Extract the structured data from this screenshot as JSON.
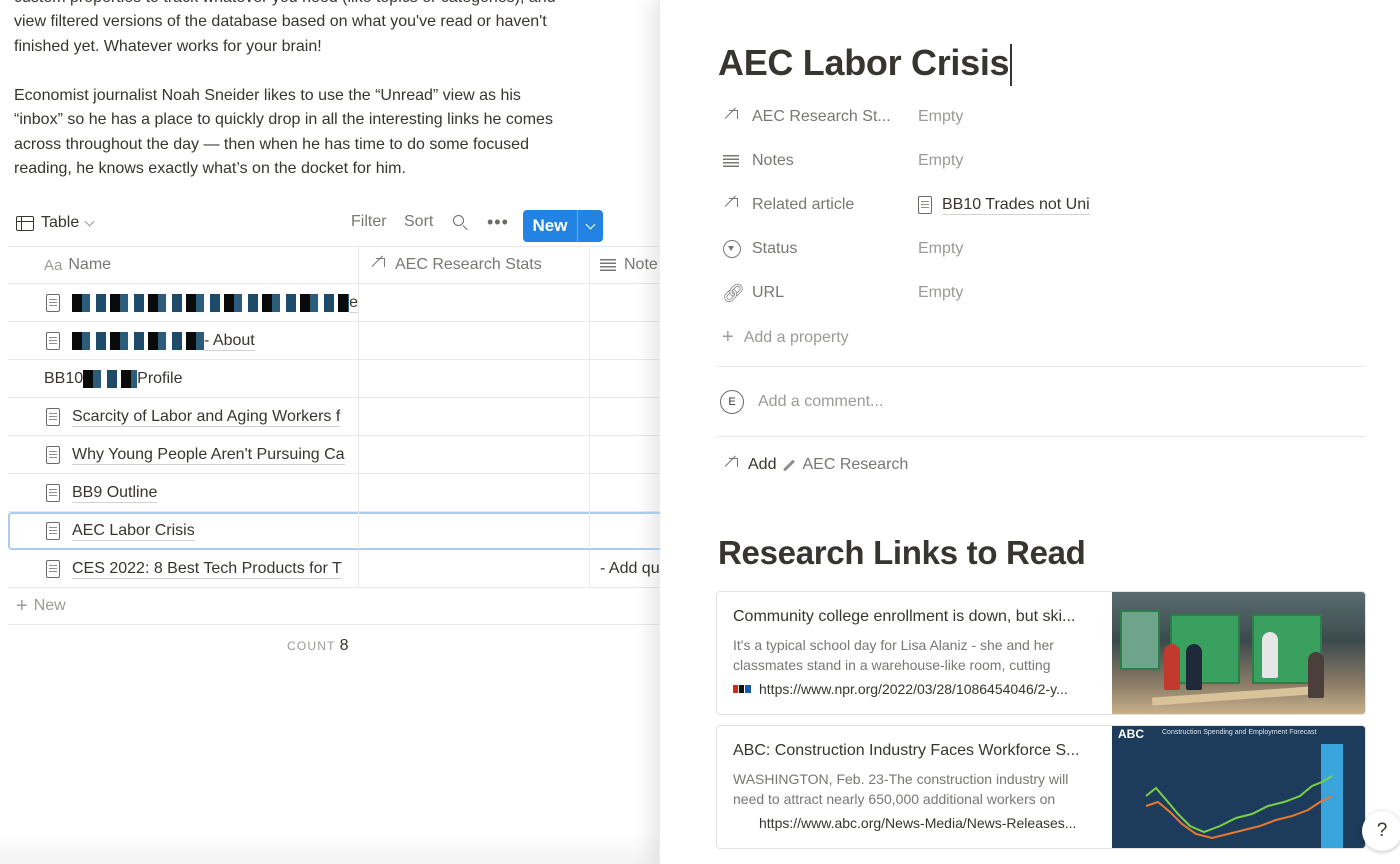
{
  "left": {
    "intro_paragraph_1": "custom properties to track whatever you need (like topics or categories), and view filtered versions of the database based on what you've read or haven't finished yet. Whatever works for your brain!",
    "intro_paragraph_2": "Economist journalist Noah Sneider likes to use the “Unread” view as his “inbox” so he has a place to quickly drop in all the interesting links he comes across throughout the day — then when he has time to do some focused reading, he knows exactly what’s on the docket for him.",
    "view_label": "Table",
    "toolbar": {
      "filter": "Filter",
      "sort": "Sort",
      "more": "•••",
      "new": "New"
    },
    "columns": {
      "name_prefix": "Aa",
      "name": "Name",
      "stats": "AEC Research Stats",
      "notes": "Note"
    },
    "rows": [
      {
        "suffix": "e",
        "notes": ""
      },
      {
        "suffix": " - About",
        "notes": ""
      },
      {
        "prefix": "BB10 ",
        "suffix": "Profile",
        "notes": ""
      },
      {
        "title": "Scarcity of Labor and Aging Workers f",
        "notes": ""
      },
      {
        "title": "Why Young People Aren't Pursuing Ca",
        "notes": ""
      },
      {
        "title": "BB9 Outline",
        "notes": ""
      },
      {
        "title": "AEC Labor Crisis",
        "notes": ""
      },
      {
        "title": "CES 2022: 8 Best Tech Products for T",
        "notes": "- Add qu"
      }
    ],
    "new_row": "New",
    "count_label": "COUNT",
    "count_value": "8"
  },
  "peek": {
    "title": "AEC Labor Crisis",
    "properties": [
      {
        "name": "AEC Research St...",
        "value": "Empty",
        "icon": "relation-arrow-icon"
      },
      {
        "name": "Notes",
        "value": "Empty",
        "icon": "text-lines-icon"
      },
      {
        "name": "Related article",
        "value": "BB10 Trades not Uni",
        "icon": "relation-arrow-icon"
      },
      {
        "name": "Status",
        "value": "Empty",
        "icon": "status-icon"
      },
      {
        "name": "URL",
        "value": "Empty",
        "icon": "link-icon"
      }
    ],
    "add_property": "Add a property",
    "comment_avatar": "E",
    "comment_placeholder": "Add a comment...",
    "add_relation_prefix": "Add",
    "add_relation_target": "AEC Research",
    "section_heading": "Research Links to Read",
    "bookmarks": [
      {
        "title": "Community college enrollment is down, but ski...",
        "description": "It's a typical school day for Lisa Alaniz - she and her classmates stand in a warehouse-like room, cutting",
        "url": "https://www.npr.org/2022/03/28/1086454046/2-y..."
      },
      {
        "title": "ABC: Construction Industry Faces Workforce S...",
        "description": "WASHINGTON, Feb. 23-The construction industry will need to attract nearly 650,000 additional workers on",
        "url": "https://www.abc.org/News-Media/News-Releases...",
        "image_logo": "ABC",
        "image_heading": "Construction Spending and Employment Forecast"
      }
    ]
  },
  "help": "?"
}
